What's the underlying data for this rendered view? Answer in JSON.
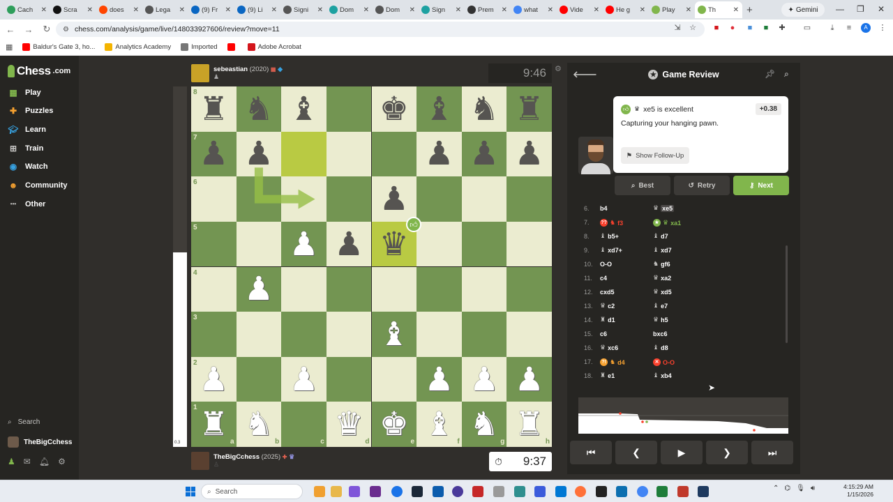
{
  "browser": {
    "tabs": [
      {
        "label": "Cach",
        "color": "#2e9e5b"
      },
      {
        "label": "Scra",
        "color": "#111111"
      },
      {
        "label": "does",
        "color": "#ff4500"
      },
      {
        "label": "Lega",
        "color": "#555555"
      },
      {
        "label": "(9) Fr",
        "color": "#0a66c2"
      },
      {
        "label": "(9) Li",
        "color": "#0a66c2"
      },
      {
        "label": "Signi",
        "color": "#555555"
      },
      {
        "label": "Dom",
        "color": "#1da1a1"
      },
      {
        "label": "Dom",
        "color": "#555555"
      },
      {
        "label": "Sign",
        "color": "#1da1a1"
      },
      {
        "label": "Prem",
        "color": "#333333"
      },
      {
        "label": "what",
        "color": "#4285f4"
      },
      {
        "label": "Vide",
        "color": "#ff0000"
      },
      {
        "label": "He g",
        "color": "#ff0000"
      },
      {
        "label": "Play",
        "color": "#81b64c"
      },
      {
        "label": "Th",
        "color": "#81b64c",
        "active": true
      }
    ],
    "new_tab": "+",
    "gemini": "Gemini",
    "url": "chess.com/analysis/game/live/148033927606/review?move=11",
    "bookmarks": [
      {
        "label": "Baldur's Gate 3, ho...",
        "color": "#ff0000"
      },
      {
        "label": "Analytics Academy",
        "color": "#f4b400"
      },
      {
        "label": "Imported",
        "color": "#777777"
      },
      {
        "label": "",
        "color": "#ff0000"
      },
      {
        "label": "Adobe Acrobat",
        "color": "#d4161c"
      }
    ]
  },
  "sidebar": {
    "logo": "Chess",
    "logo_suffix": ".com",
    "items": [
      {
        "label": "Play",
        "icon": "board-icon"
      },
      {
        "label": "Puzzles",
        "icon": "puzzle-icon"
      },
      {
        "label": "Learn",
        "icon": "graduation-cap-icon"
      },
      {
        "label": "Train",
        "icon": "dumbbell-icon"
      },
      {
        "label": "Watch",
        "icon": "binoculars-icon"
      },
      {
        "label": "Community",
        "icon": "community-icon"
      },
      {
        "label": "Other",
        "icon": "more-dots-icon"
      }
    ],
    "search": "Search",
    "username": "TheBigCchess"
  },
  "game": {
    "top_player": {
      "name": "sebeastian",
      "rating": "(2020)",
      "clock": "9:46"
    },
    "bottom_player": {
      "name": "TheBigCchess",
      "rating": "(2025)",
      "clock": "9:37"
    },
    "eval_label": "0.3",
    "eval_white_fraction": 0.54,
    "files": [
      "a",
      "b",
      "c",
      "d",
      "e",
      "f",
      "g",
      "h"
    ],
    "ranks": [
      "8",
      "7",
      "6",
      "5",
      "4",
      "3",
      "2",
      "1"
    ],
    "pieces": [
      {
        "sq": "a8",
        "p": "♜",
        "c": "b"
      },
      {
        "sq": "b8",
        "p": "♞",
        "c": "b"
      },
      {
        "sq": "c8",
        "p": "♝",
        "c": "b"
      },
      {
        "sq": "e8",
        "p": "♚",
        "c": "b"
      },
      {
        "sq": "f8",
        "p": "♝",
        "c": "b"
      },
      {
        "sq": "g8",
        "p": "♞",
        "c": "b"
      },
      {
        "sq": "h8",
        "p": "♜",
        "c": "b"
      },
      {
        "sq": "a7",
        "p": "♟",
        "c": "b"
      },
      {
        "sq": "b7",
        "p": "♟",
        "c": "b"
      },
      {
        "sq": "f7",
        "p": "♟",
        "c": "b"
      },
      {
        "sq": "g7",
        "p": "♟",
        "c": "b"
      },
      {
        "sq": "h7",
        "p": "♟",
        "c": "b"
      },
      {
        "sq": "e6",
        "p": "♟",
        "c": "b"
      },
      {
        "sq": "c5",
        "p": "♟",
        "c": "w"
      },
      {
        "sq": "d5",
        "p": "♟",
        "c": "b"
      },
      {
        "sq": "e5",
        "p": "♛",
        "c": "b"
      },
      {
        "sq": "b4",
        "p": "♟",
        "c": "w"
      },
      {
        "sq": "e3",
        "p": "♝",
        "c": "w"
      },
      {
        "sq": "a2",
        "p": "♟",
        "c": "w"
      },
      {
        "sq": "c2",
        "p": "♟",
        "c": "w"
      },
      {
        "sq": "f2",
        "p": "♟",
        "c": "w"
      },
      {
        "sq": "g2",
        "p": "♟",
        "c": "w"
      },
      {
        "sq": "h2",
        "p": "♟",
        "c": "w"
      },
      {
        "sq": "a1",
        "p": "♜",
        "c": "w"
      },
      {
        "sq": "b1",
        "p": "♞",
        "c": "w"
      },
      {
        "sq": "d1",
        "p": "♛",
        "c": "w"
      },
      {
        "sq": "e1",
        "p": "♚",
        "c": "w"
      },
      {
        "sq": "f1",
        "p": "♝",
        "c": "w"
      },
      {
        "sq": "g1",
        "p": "♞",
        "c": "w"
      },
      {
        "sq": "h1",
        "p": "♜",
        "c": "w"
      }
    ],
    "highlights": [
      "c7",
      "e5"
    ],
    "arrow": {
      "from": "b7",
      "to": "c6"
    }
  },
  "review": {
    "title": "Game Review",
    "move_text": "xe5 is excellent",
    "score": "+0.38",
    "description": "Capturing your hanging pawn.",
    "follow_up": "Show Follow-Up",
    "buttons": {
      "best": "Best",
      "retry": "Retry",
      "next": "Next"
    },
    "moves": [
      {
        "n": "6.",
        "w": "b4",
        "wp": "",
        "b": "xe5",
        "bp": "♛",
        "bhl": true
      },
      {
        "n": "7.",
        "w": "f3",
        "wp": "♞",
        "wi": "??",
        "wcol": "red",
        "b": "xa1",
        "bp": "♛",
        "bi": "★",
        "bcol": "green"
      },
      {
        "n": "8.",
        "w": "b5+",
        "wp": "♝",
        "b": "d7",
        "bp": "♝"
      },
      {
        "n": "9.",
        "w": "xd7+",
        "wp": "♝",
        "b": "xd7",
        "bp": "♝"
      },
      {
        "n": "10.",
        "w": "O-O",
        "wp": "",
        "b": "gf6",
        "bp": "♞"
      },
      {
        "n": "11.",
        "w": "c4",
        "wp": "",
        "b": "xa2",
        "bp": "♛"
      },
      {
        "n": "12.",
        "w": "cxd5",
        "wp": "",
        "b": "xd5",
        "bp": "♛"
      },
      {
        "n": "13.",
        "w": "c2",
        "wp": "♛",
        "b": "e7",
        "bp": "♝"
      },
      {
        "n": "14.",
        "w": "d1",
        "wp": "♜",
        "b": "h5",
        "bp": "♛"
      },
      {
        "n": "15.",
        "w": "c6",
        "wp": "",
        "b": "bxc6",
        "bp": ""
      },
      {
        "n": "16.",
        "w": "xc6",
        "wp": "♛",
        "b": "d8",
        "bp": "♝"
      },
      {
        "n": "17.",
        "w": "d4",
        "wp": "♞",
        "wi": "?!",
        "wcol": "orange",
        "b": "O-O",
        "bp": "",
        "bi": "✕",
        "bcol": "red"
      },
      {
        "n": "18.",
        "w": "e1",
        "wp": "♜",
        "b": "xb4",
        "bp": "♝"
      }
    ]
  },
  "taskbar": {
    "search": "Search",
    "time": "4:15:29 AM",
    "date": "1/15/2026"
  },
  "colors": {
    "board_light": "#ebecd0",
    "board_dark": "#739552",
    "accent": "#81b64c"
  }
}
